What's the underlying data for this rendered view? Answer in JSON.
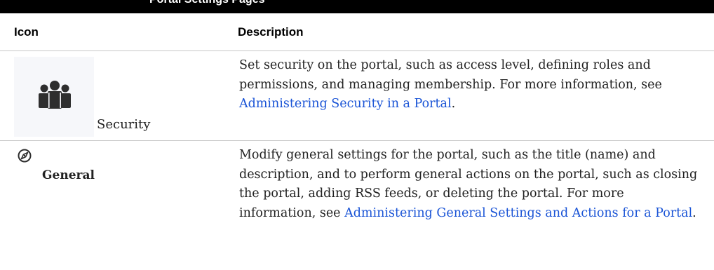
{
  "page_heading": "Portal Settings Pages",
  "table": {
    "col_icon": "Icon",
    "col_description": "Description",
    "rows": [
      {
        "icon_name": "security-people-icon",
        "label": "Security",
        "text_before": "Set security on the portal, such as access level, defining roles and permissions, and managing membership. For more information, see ",
        "link_text": "Administering Security in a Portal",
        "text_after": "."
      },
      {
        "icon_name": "compass-icon",
        "label": "General",
        "text_before": "Modify general settings for the portal, such as the title (name) and description, and to perform general actions on the portal, such as closing the portal, adding RSS feeds, or deleting the portal. For more information, see ",
        "link_text": "Administering General Settings and Actions for a Portal",
        "text_after": "."
      }
    ]
  },
  "colors": {
    "link": "#1a54d6",
    "text": "#222222",
    "icon": "#2e2e2e",
    "icon_tile_bg": "#f6f7fa"
  }
}
